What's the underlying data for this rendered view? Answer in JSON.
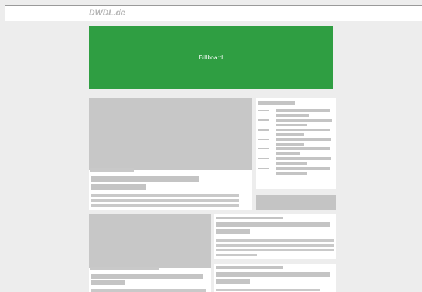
{
  "header": {
    "logo_text": "DWDL.de"
  },
  "billboard": {
    "label": "Billboard",
    "color": "#2f9e42"
  },
  "colors": {
    "page_background": "#ededed",
    "placeholder": "#c4c4c4",
    "card_background": "#ffffff"
  }
}
